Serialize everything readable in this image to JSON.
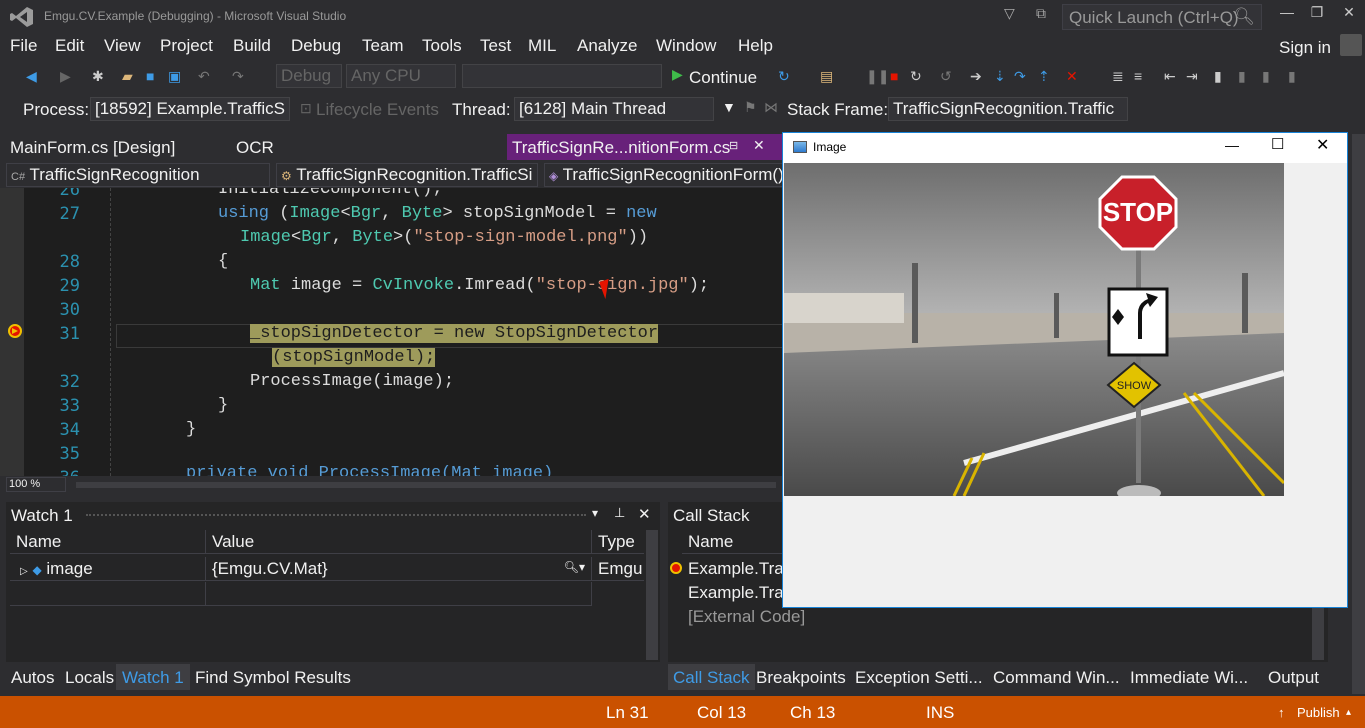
{
  "window": {
    "title": "Emgu.CV.Example (Debugging) - Microsoft Visual Studio",
    "quick_launch": "Quick Launch (Ctrl+Q)",
    "sign_in": "Sign in"
  },
  "menu": [
    "File",
    "Edit",
    "View",
    "Project",
    "Build",
    "Debug",
    "Team",
    "Tools",
    "Test",
    "MIL",
    "Analyze",
    "Window",
    "Help"
  ],
  "toolbar": {
    "config": "Debug",
    "platform": "Any CPU",
    "continue": "Continue"
  },
  "debug_location": {
    "process_label": "Process:",
    "process": "[18592] Example.TrafficS",
    "lifecycle": "Lifecycle Events",
    "thread_label": "Thread:",
    "thread": "[6128] Main Thread",
    "frame_label": "Stack Frame:",
    "frame": "TrafficSignRecognition.Traffic"
  },
  "tabs": [
    {
      "label": "MainForm.cs [Design]"
    },
    {
      "label": "OCR"
    },
    {
      "label": "TrafficSignRe...nitionForm.cs"
    }
  ],
  "nav": {
    "project": "TrafficSignRecognition",
    "type": "TrafficSignRecognition.TrafficSi",
    "member": "TrafficSignRecognitionForm()"
  },
  "code": {
    "line_numbers": [
      "26",
      "27",
      "",
      "28",
      "29",
      "30",
      "31",
      "",
      "32",
      "33",
      "34",
      "35",
      "36"
    ],
    "l26": "InitializeComponent();",
    "l27a_kw": "using",
    "l27a_1": " (",
    "l27a_ty": "Image",
    "l27a_2": "<",
    "l27a_ty2": "Bgr",
    "l27a_3": ", ",
    "l27a_ty3": "Byte",
    "l27a_4": "> stopSignModel = ",
    "l27a_new": "new",
    "l27b_ty": "Image",
    "l27b_1": "<",
    "l27b_ty2": "Bgr",
    "l27b_2": ", ",
    "l27b_ty3": "Byte",
    "l27b_3": ">(",
    "l27b_st": "\"stop-sign-model.png\"",
    "l27b_4": "))",
    "l28": "{",
    "l29_ty": "Mat",
    "l29_1": " image = ",
    "l29_ty2": "CvInvoke",
    "l29_2": ".Imread(",
    "l29_st": "\"stop-sign.jpg\"",
    "l29_3": ");",
    "l31a": "_stopSignDetector = new StopSignDetector",
    "l31b": "(stopSignModel);",
    "l32": "ProcessImage(image);",
    "l33": "}",
    "l34": "}",
    "l36": "private void ProcessImage(Mat image)"
  },
  "zoom": "100 %",
  "watch": {
    "title": "Watch 1",
    "columns": [
      "Name",
      "Value",
      "Type"
    ],
    "rows": [
      {
        "name": "image",
        "value": "{Emgu.CV.Mat}",
        "type": "Emgu"
      }
    ]
  },
  "callstack": {
    "title": "Call Stack",
    "columns": [
      "Name"
    ],
    "rows": [
      "Example.Traf",
      "Example.Traf",
      "[External Code]"
    ]
  },
  "bottom_tabs_left": [
    "Autos",
    "Locals",
    "Watch 1",
    "Find Symbol Results"
  ],
  "bottom_tabs_right": [
    "Call Stack",
    "Breakpoints",
    "Exception Setti...",
    "Command Win...",
    "Immediate Wi...",
    "Output"
  ],
  "image_window": {
    "title": "Image",
    "sign_text": "STOP",
    "sign_text2": "SHOW"
  },
  "status": {
    "ln": "Ln 31",
    "col": "Col 13",
    "ch": "Ch 13",
    "ins": "INS",
    "publish": "Publish"
  }
}
